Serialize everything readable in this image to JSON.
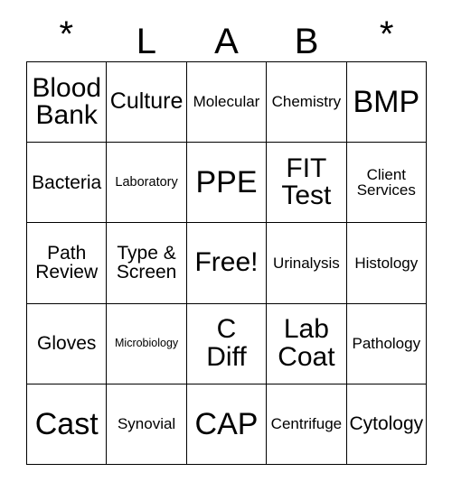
{
  "card": {
    "title_letters": [
      "*",
      "L",
      "A",
      "B",
      "*"
    ],
    "columns": 5,
    "rows": 5,
    "border_color": "#000000",
    "background_color": "#ffffff",
    "text_color": "#000000",
    "free_space": "Free!",
    "cells": [
      [
        {
          "text": "Blood\nBank",
          "size": "xl"
        },
        {
          "text": "Culture",
          "size": "lg"
        },
        {
          "text": "Molecular",
          "size": "sm"
        },
        {
          "text": "Chemistry",
          "size": "sm"
        },
        {
          "text": "BMP",
          "size": "xxl"
        }
      ],
      [
        {
          "text": "Bacteria",
          "size": "md"
        },
        {
          "text": "Laboratory",
          "size": "xs"
        },
        {
          "text": "PPE",
          "size": "xxl"
        },
        {
          "text": "FIT\nTest",
          "size": "xl"
        },
        {
          "text": "Client\nServices",
          "size": "sm"
        }
      ],
      [
        {
          "text": "Path\nReview",
          "size": "md"
        },
        {
          "text": "Type &\nScreen",
          "size": "md"
        },
        {
          "text": "Free!",
          "size": "xl"
        },
        {
          "text": "Urinalysis",
          "size": "sm"
        },
        {
          "text": "Histology",
          "size": "sm"
        }
      ],
      [
        {
          "text": "Gloves",
          "size": "md"
        },
        {
          "text": "Microbiology",
          "size": "xxs"
        },
        {
          "text": "C\nDiff",
          "size": "xl"
        },
        {
          "text": "Lab\nCoat",
          "size": "xl"
        },
        {
          "text": "Pathology",
          "size": "sm"
        }
      ],
      [
        {
          "text": "Cast",
          "size": "xxl"
        },
        {
          "text": "Synovial",
          "size": "sm"
        },
        {
          "text": "CAP",
          "size": "xxl"
        },
        {
          "text": "Centrifuge",
          "size": "sm"
        },
        {
          "text": "Cytology",
          "size": "md"
        }
      ]
    ]
  }
}
